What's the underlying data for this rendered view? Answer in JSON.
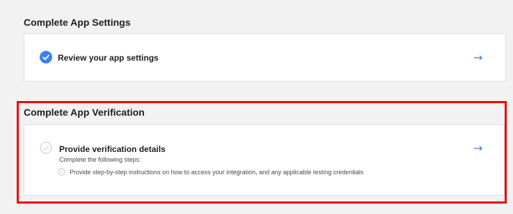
{
  "settings": {
    "title": "Complete App Settings",
    "row_label": "Review your app settings",
    "status": "completed"
  },
  "verification": {
    "title": "Complete App Verification",
    "row_label": "Provide verification details",
    "subtext": "Complete the following steps:",
    "step_1": "Provide step-by-step instructions on how to access your integration, and any applicable testing credentials",
    "status": "pending"
  },
  "colors": {
    "accent": "#3b82e8",
    "highlight": "#ee0000",
    "check_outline": "#c4c7cc"
  },
  "icons": {
    "completed": "check-circle-filled-icon",
    "pending": "check-circle-outline-icon",
    "navigate": "arrow-right-icon"
  }
}
